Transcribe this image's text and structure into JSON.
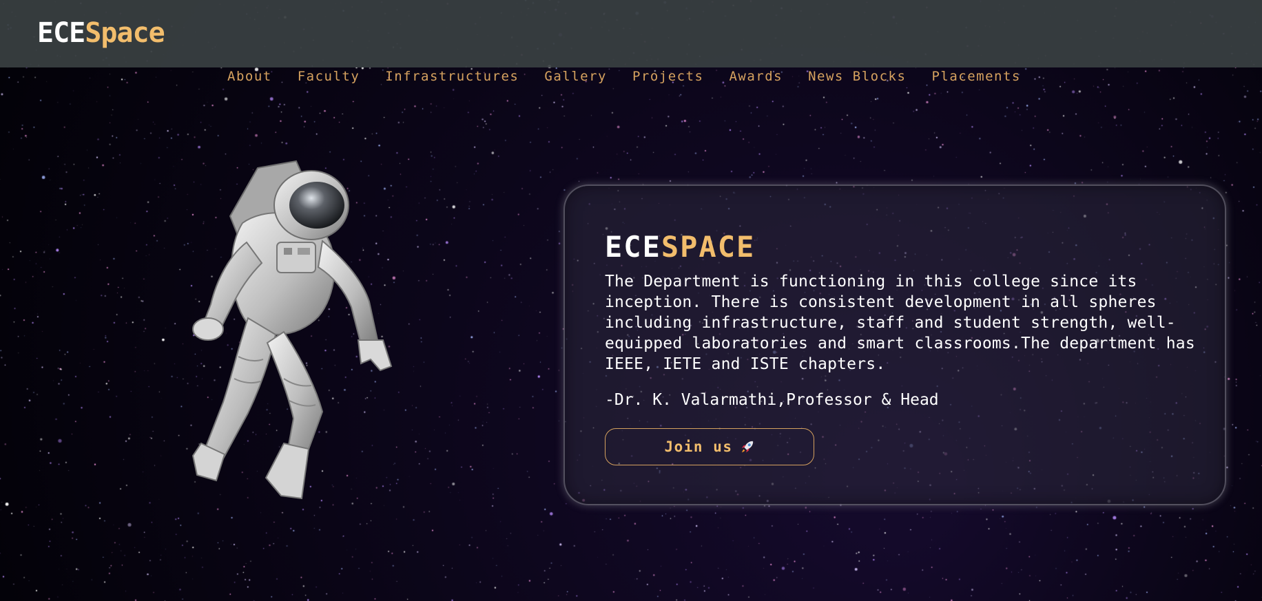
{
  "brand": {
    "prefix": "ECE",
    "suffix": "Space"
  },
  "nav": {
    "items": [
      {
        "label": "About"
      },
      {
        "label": "Faculty"
      },
      {
        "label": "Infrastructures"
      },
      {
        "label": "Gallery"
      },
      {
        "label": "Projects"
      },
      {
        "label": "Awards"
      },
      {
        "label": "News Blocks"
      },
      {
        "label": "Placements"
      }
    ]
  },
  "hero": {
    "title_prefix": "ECE",
    "title_suffix": "SPACE",
    "description": "The Department is functioning in this college since its inception. There is consistent development in all spheres including infrastructure, staff and student strength, well-equipped laboratories and smart classrooms.The department has IEEE, IETE and ISTE chapters.",
    "author": "-Dr. K. Valarmathi,Professor & Head",
    "join_label": "Join us",
    "join_icon": "rocket-icon"
  },
  "colors": {
    "accent": "#f2bd6c",
    "nav_text": "#d6a25f",
    "header_bg": "#394042",
    "page_bg": "#05030c"
  }
}
